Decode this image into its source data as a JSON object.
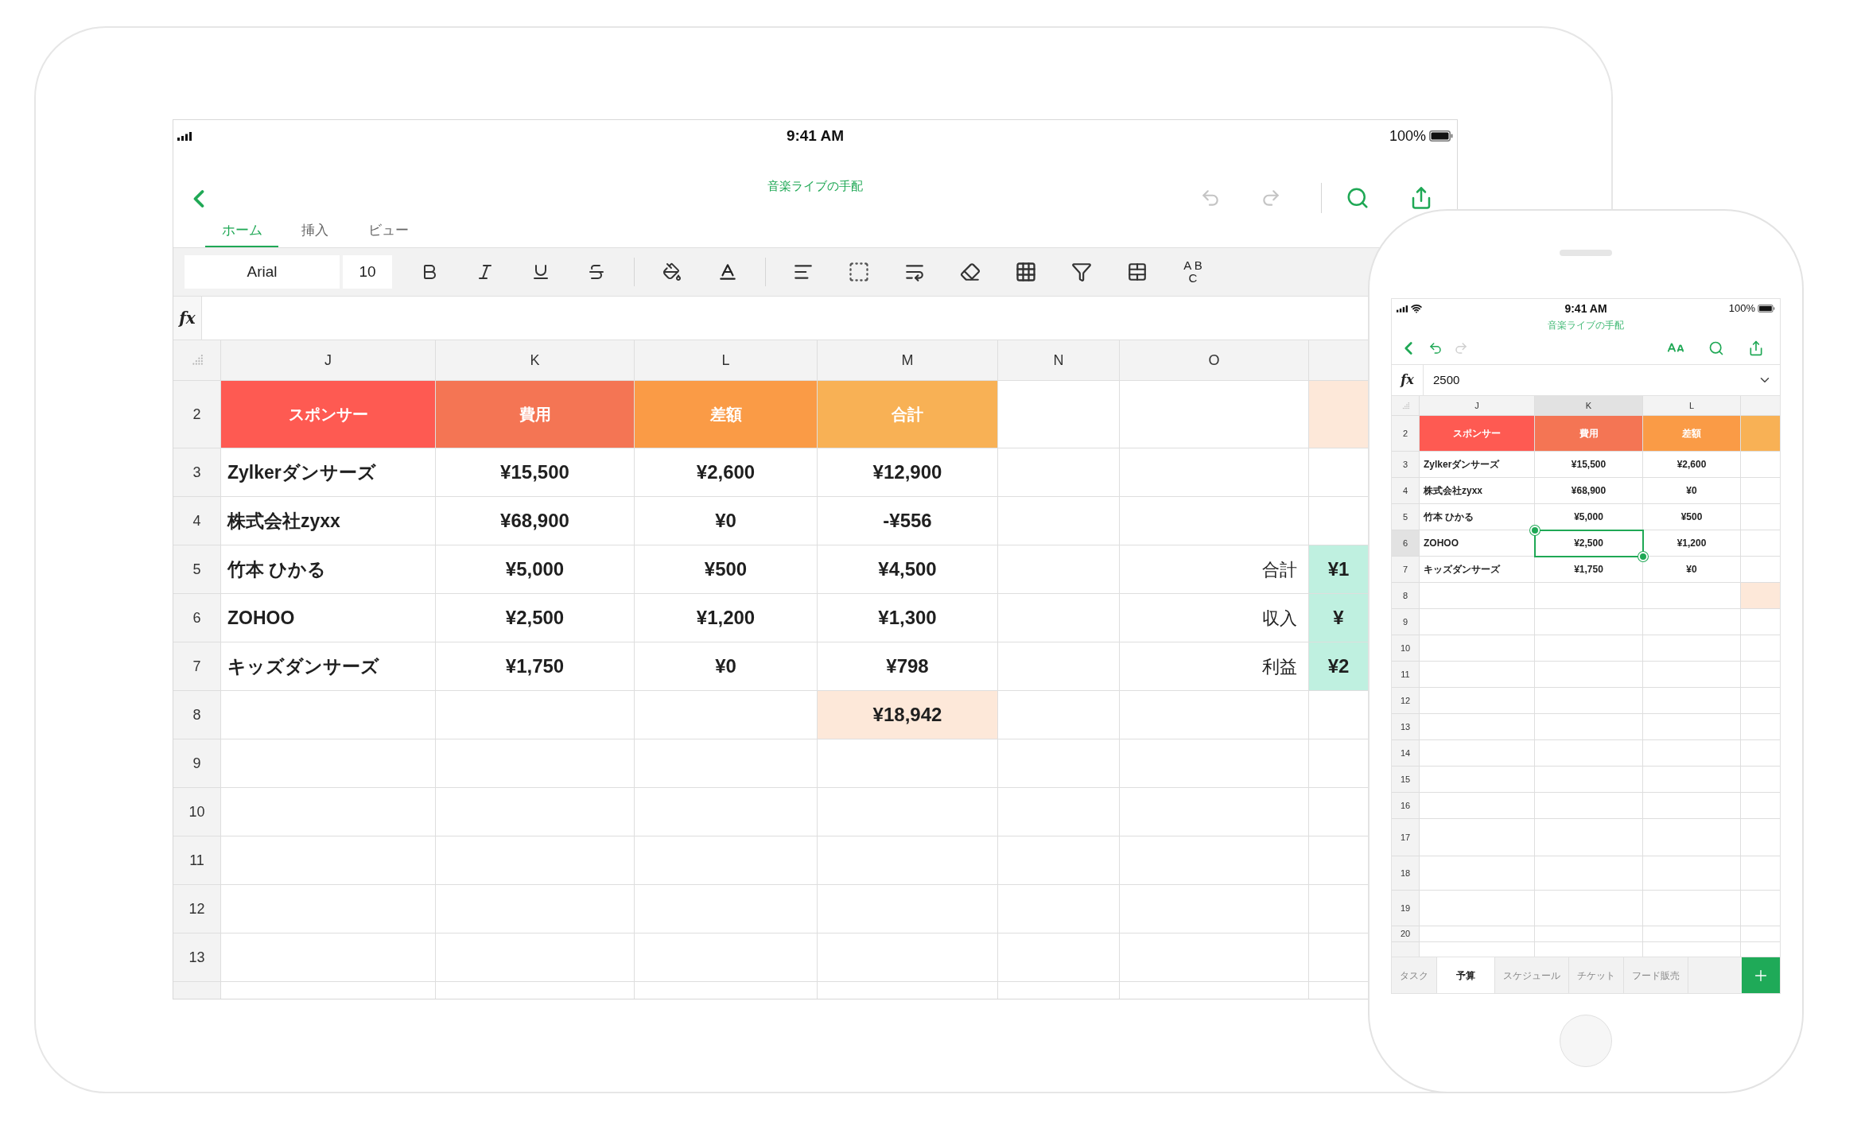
{
  "tablet": {
    "status_bar": {
      "time": "9:41 AM",
      "battery": "100%"
    },
    "title": "音楽ライブの手配",
    "tabs": [
      {
        "label": "ホーム",
        "selected": true
      },
      {
        "label": "挿入",
        "selected": false
      },
      {
        "label": "ビュー",
        "selected": false
      }
    ],
    "toolbar": {
      "font": "Arial",
      "font_size": "10",
      "spell_button": [
        "A B",
        "C"
      ]
    },
    "formula_bar": {
      "label": "fx"
    },
    "sheet": {
      "columns": [
        "J",
        "K",
        "L",
        "M",
        "N",
        "O"
      ],
      "rows": [
        {
          "number": "2",
          "cells": [
            {
              "kind": "header",
              "text": "スポンサー",
              "color": "#fe5a52"
            },
            {
              "kind": "header",
              "text": "費用",
              "color": "#f47554"
            },
            {
              "kind": "header",
              "text": "差額",
              "color": "#fa9b46"
            },
            {
              "kind": "header",
              "text": "合計",
              "color": "#f8b155"
            },
            {},
            {},
            {
              "color": "#fde8d9"
            }
          ]
        },
        {
          "number": "3",
          "cells": [
            {
              "kind": "name",
              "text": "Zylkerダンサーズ"
            },
            {
              "kind": "value",
              "text": "¥15,500"
            },
            {
              "kind": "value",
              "text": "¥2,600"
            },
            {
              "kind": "value",
              "text": "¥12,900"
            },
            {},
            {},
            {}
          ]
        },
        {
          "number": "4",
          "cells": [
            {
              "kind": "name",
              "text": "株式会社zyxx"
            },
            {
              "kind": "value",
              "text": "¥68,900"
            },
            {
              "kind": "value",
              "text": "¥0"
            },
            {
              "kind": "value",
              "text": "-¥556"
            },
            {},
            {},
            {}
          ]
        },
        {
          "number": "5",
          "cells": [
            {
              "kind": "name",
              "text": "竹本 ひかる"
            },
            {
              "kind": "value",
              "text": "¥5,000"
            },
            {
              "kind": "value",
              "text": "¥500"
            },
            {
              "kind": "value",
              "text": "¥4,500"
            },
            {},
            {
              "kind": "label",
              "text": "合計"
            },
            {
              "kind": "value",
              "text": "¥1",
              "color": "#bff0e0"
            }
          ]
        },
        {
          "number": "6",
          "cells": [
            {
              "kind": "name",
              "text": "ZOHOO"
            },
            {
              "kind": "value",
              "text": "¥2,500"
            },
            {
              "kind": "value",
              "text": "¥1,200"
            },
            {
              "kind": "value",
              "text": "¥1,300"
            },
            {},
            {
              "kind": "label",
              "text": "収入"
            },
            {
              "kind": "value",
              "text": "¥",
              "color": "#bff0e0"
            }
          ]
        },
        {
          "number": "7",
          "cells": [
            {
              "kind": "name",
              "text": "キッズダンサーズ"
            },
            {
              "kind": "value",
              "text": "¥1,750"
            },
            {
              "kind": "value",
              "text": "¥0"
            },
            {
              "kind": "value",
              "text": "¥798"
            },
            {},
            {
              "kind": "label",
              "text": "利益"
            },
            {
              "kind": "value",
              "text": "¥2",
              "color": "#bff0e0"
            }
          ]
        },
        {
          "number": "8",
          "cells": [
            {},
            {},
            {},
            {
              "kind": "value",
              "text": "¥18,942",
              "color": "#fde8d9"
            },
            {},
            {},
            {}
          ]
        },
        {
          "number": "9"
        },
        {
          "number": "10"
        },
        {
          "number": "11"
        },
        {
          "number": "12"
        },
        {
          "number": "13"
        }
      ]
    }
  },
  "phone": {
    "status_bar": {
      "time": "9:41 AM",
      "battery": "100%"
    },
    "title": "音楽ライブの手配",
    "formula_bar": {
      "label": "fx",
      "value": "2500"
    },
    "sheet": {
      "columns": [
        "J",
        "K",
        "L"
      ],
      "rows": [
        {
          "number": "2",
          "cells": [
            {
              "kind": "header",
              "text": "スポンサー",
              "color": "#fe5a52",
              "selected": false
            },
            {
              "kind": "header",
              "text": "費用",
              "color": "#f47554",
              "selected": false
            },
            {
              "kind": "header",
              "text": "差額",
              "color": "#fa9b46",
              "selected": false
            },
            {
              "color": "#f8b155",
              "selected": false
            }
          ]
        },
        {
          "number": "3",
          "cells": [
            {
              "kind": "name",
              "text": "Zylkerダンサーズ",
              "selected": false
            },
            {
              "kind": "value",
              "text": "¥15,500",
              "selected": false
            },
            {
              "kind": "value",
              "text": "¥2,600",
              "selected": false
            },
            {
              "selected": false
            }
          ]
        },
        {
          "number": "4",
          "cells": [
            {
              "kind": "name",
              "text": "株式会社zyxx",
              "selected": false
            },
            {
              "kind": "value",
              "text": "¥68,900",
              "selected": false
            },
            {
              "kind": "value",
              "text": "¥0",
              "selected": false
            },
            {
              "selected": false
            }
          ]
        },
        {
          "number": "5",
          "cells": [
            {
              "kind": "name",
              "text": "竹本 ひかる",
              "selected": false
            },
            {
              "kind": "value",
              "text": "¥5,000",
              "selected": false
            },
            {
              "kind": "value",
              "text": "¥500",
              "selected": false
            },
            {
              "selected": false
            }
          ]
        },
        {
          "number": "6",
          "cells": [
            {
              "kind": "name",
              "text": "ZOHOO",
              "selected": false
            },
            {
              "kind": "value",
              "text": "¥2,500",
              "selected": true
            },
            {
              "kind": "value",
              "text": "¥1,200",
              "selected": false
            },
            {
              "selected": false
            }
          ]
        },
        {
          "number": "7",
          "cells": [
            {
              "kind": "name",
              "text": "キッズダンサーズ",
              "selected": false
            },
            {
              "kind": "value",
              "text": "¥1,750",
              "selected": false
            },
            {
              "kind": "value",
              "text": "¥0",
              "selected": false
            },
            {
              "selected": false
            }
          ]
        },
        {
          "number": "8",
          "cells": [
            {
              "selected": false
            },
            {
              "selected": false
            },
            {
              "selected": false
            },
            {
              "color": "#fde8d9",
              "selected": false
            }
          ]
        },
        {
          "number": "9"
        },
        {
          "number": "10"
        },
        {
          "number": "11"
        },
        {
          "number": "12"
        },
        {
          "number": "13"
        },
        {
          "number": "14"
        },
        {
          "number": "15"
        },
        {
          "number": "16"
        },
        {
          "number": "17"
        },
        {
          "number": "18"
        },
        {
          "number": "19"
        },
        {
          "number": "20"
        }
      ]
    },
    "sheet_tabs": [
      {
        "label": "タスク",
        "selected": false
      },
      {
        "label": "予算",
        "selected": true
      },
      {
        "label": "スケジュール",
        "selected": false
      },
      {
        "label": "チケット",
        "selected": false
      },
      {
        "label": "フード販売",
        "selected": false
      }
    ]
  }
}
